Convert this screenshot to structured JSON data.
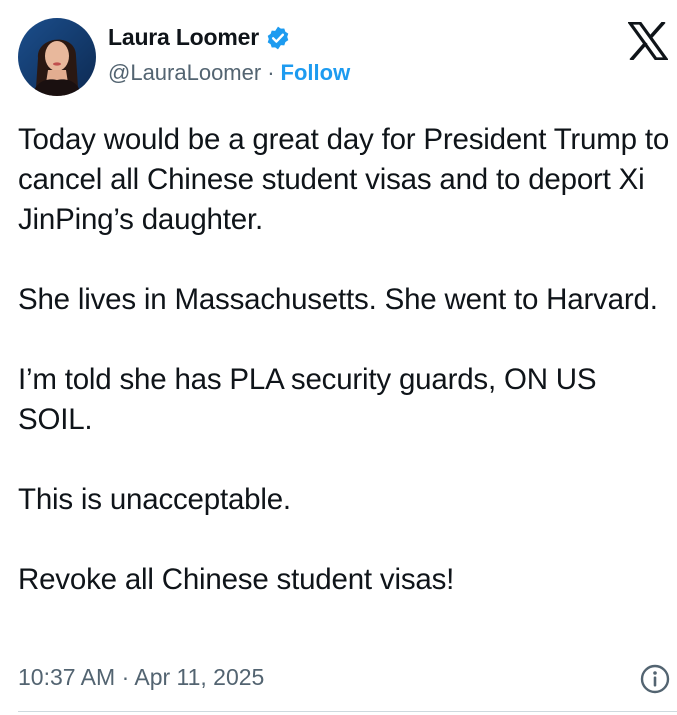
{
  "author": {
    "display_name": "Laura Loomer",
    "handle": "@LauraLoomer",
    "separator": "·",
    "follow_label": "Follow",
    "verified_icon": "verified-badge-icon",
    "avatar_icon": "profile-avatar"
  },
  "platform": {
    "logo_icon": "x-logo-icon"
  },
  "tweet": {
    "paragraphs": [
      "Today would be a great day for President Trump to cancel all Chinese student visas and to deport Xi JinPing’s daughter.",
      "She lives in Massachusetts. She went to Harvard.",
      "I’m told she has PLA security guards, ON US SOIL.",
      "This is unacceptable.",
      "Revoke all Chinese student visas!"
    ],
    "timestamp": "10:37 AM · Apr 11, 2025",
    "info_icon": "info-icon"
  },
  "colors": {
    "text": "#0f1419",
    "secondary": "#536471",
    "accent": "#1d9bf0"
  }
}
